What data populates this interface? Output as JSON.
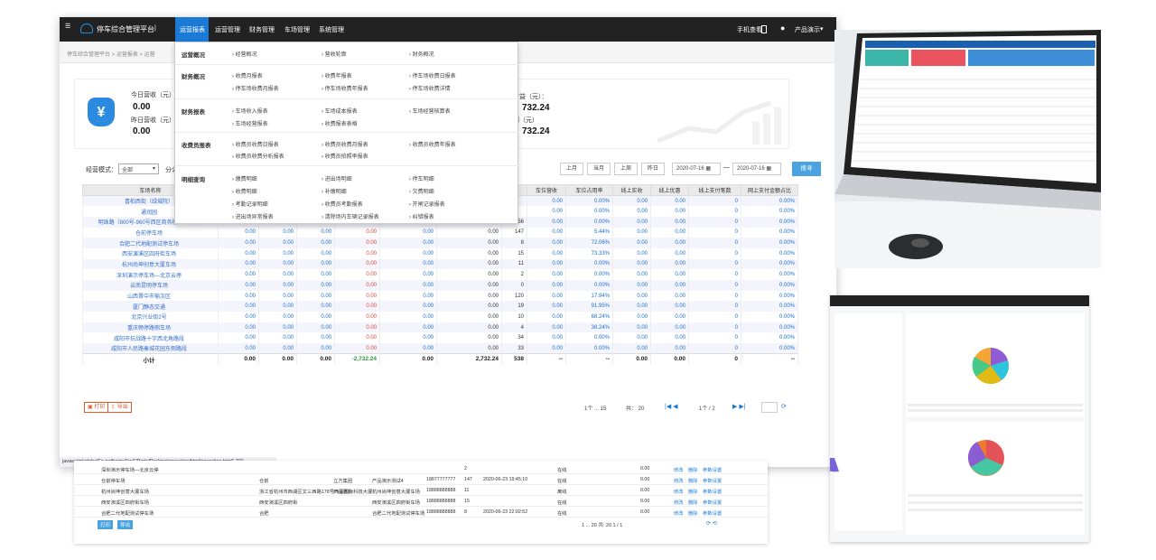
{
  "topbar": {
    "brand": "停车综合管理平台",
    "nav": [
      "运营报表",
      "运营管理",
      "财务管理",
      "车场管理",
      "系统管理"
    ],
    "mobile": "手机查看",
    "user": "产品演示"
  },
  "breadcrumb": "停车综合管理平台 > 运营报表 > 运营",
  "stats": {
    "today_label": "今日营收（元）",
    "today_value": "0.00",
    "yesterday_label": "昨日营收（元）",
    "yesterday_value": "0.00",
    "right_label1": "收益（元）：",
    "right_value1": "732.24",
    "right_label2": "利（元）",
    "right_value2": "732.24"
  },
  "menu": [
    {
      "head": "运营概况",
      "items": [
        "经营概况",
        "营收轮廓",
        "财务概况"
      ]
    },
    {
      "head": "财务概况",
      "items": [
        "收费月报表",
        "收费年报表",
        "停车场收费日报表",
        "停车场收费月报表",
        "停车场收费年报表",
        "停车场收费详情"
      ]
    },
    {
      "head": "财务报表",
      "items": [
        "车场收入报表",
        "车场成本报表",
        "车场经营核算表",
        "车场经营报表",
        "收费报表表格"
      ]
    },
    {
      "head": "收费员报表",
      "items": [
        "收费员收费日报表",
        "收费员收费月报表",
        "收费员收费年报表",
        "收费员收费分析报表",
        "收费员拍照率报表"
      ]
    },
    {
      "head": "明细查询",
      "items": [
        "缴费明细",
        "进出场明细",
        "停车明细",
        "收费明细",
        "补缴明细",
        "欠费明细",
        "考勤记录明细",
        "收费员考勤报表",
        "开闸记录报表",
        "进出场异常报表",
        "清除场内车辆记录报表",
        "纠错报表"
      ]
    }
  ],
  "filter": {
    "mode_label": "经营模式：",
    "mode_value": "全部",
    "split": "分公",
    "buttons": [
      "上月",
      "当月",
      "上周",
      "昨日"
    ],
    "date_from": "2020-07-16",
    "date_sep": "—",
    "date_to": "2020-07-16",
    "search": "搜寻"
  },
  "table": {
    "headers": [
      "车场名称",
      "",
      "",
      "",
      "",
      "",
      "",
      "",
      "车位营收",
      "车位占用率",
      "线上实收",
      "线上优惠",
      "线上支付笔数",
      "网上支付金额占比"
    ],
    "rows": [
      [
        "喜柏西街（绿城院）",
        "",
        "",
        "",
        "",
        "",
        "",
        "",
        "0.00",
        "0.00%",
        "0.00",
        "0.00",
        "0",
        "0.00%"
      ],
      [
        "通润园",
        "",
        "",
        "",
        "",
        "",
        "",
        "",
        "0.00",
        "0.00%",
        "0.00",
        "0.00",
        "0",
        "0.00%"
      ],
      [
        "明珠路（800号-960号西区商务楼82-109）",
        "0.00",
        "0.00",
        "0.00",
        "0.00",
        "0.00",
        "0.00",
        "56",
        "0.00",
        "0.00%",
        "0.00",
        "0.00",
        "0",
        "0.00%"
      ],
      [
        "仓前停车场",
        "0.00",
        "0.00",
        "0.00",
        "0.00",
        "0.00",
        "0.00",
        "147",
        "0.00",
        "5.44%",
        "0.00",
        "0.00",
        "0",
        "0.00%"
      ],
      [
        "合肥二代地配测试停车场",
        "0.00",
        "0.00",
        "0.00",
        "0.00",
        "0.00",
        "0.00",
        "8",
        "0.00",
        "72.06%",
        "0.00",
        "0.00",
        "0",
        "0.00%"
      ],
      [
        "西安演溪区四府街车场",
        "0.00",
        "0.00",
        "0.00",
        "0.00",
        "0.00",
        "0.00",
        "15",
        "0.00",
        "73.33%",
        "0.00",
        "0.00",
        "0",
        "0.00%"
      ],
      [
        "杭州尚坤创意大厦车场",
        "0.00",
        "0.00",
        "0.00",
        "0.00",
        "0.00",
        "0.00",
        "11",
        "0.00",
        "0.00%",
        "0.00",
        "0.00",
        "0",
        "0.00%"
      ],
      [
        "深圳演示停车场—北京云停",
        "0.00",
        "0.00",
        "0.00",
        "0.00",
        "0.00",
        "0.00",
        "2",
        "0.00",
        "0.00%",
        "0.00",
        "0.00",
        "0",
        "0.00%"
      ],
      [
        "云南昆明停车场",
        "0.00",
        "0.00",
        "0.00",
        "0.00",
        "0.00",
        "0.00",
        "0",
        "0.00",
        "0.00%",
        "0.00",
        "0.00",
        "0",
        "0.00%"
      ],
      [
        "山西晋中市榆次区",
        "0.00",
        "0.00",
        "0.00",
        "0.00",
        "0.00",
        "0.00",
        "120",
        "0.00",
        "17.94%",
        "0.00",
        "0.00",
        "0",
        "0.00%"
      ],
      [
        "厦门静态交通",
        "0.00",
        "0.00",
        "0.00",
        "0.00",
        "0.00",
        "0.00",
        "19",
        "0.00",
        "91.95%",
        "0.00",
        "0.00",
        "0",
        "0.00%"
      ],
      [
        "北京兴业街2号",
        "0.00",
        "0.00",
        "0.00",
        "0.00",
        "0.00",
        "0.00",
        "10",
        "0.00",
        "68.24%",
        "0.00",
        "0.00",
        "0",
        "0.00%"
      ],
      [
        "重庆畅停路侧车场",
        "0.00",
        "0.00",
        "0.00",
        "0.00",
        "0.00",
        "0.00",
        "4",
        "0.00",
        "38.24%",
        "0.00",
        "0.00",
        "0",
        "0.00%"
      ],
      [
        "咸阳市抗战路十字西北角路段",
        "0.00",
        "0.00",
        "0.00",
        "0.00",
        "0.00",
        "0.00",
        "34",
        "0.00",
        "0.00%",
        "0.00",
        "0.00",
        "0",
        "0.00%"
      ],
      [
        "咸阳市人民路秦城花园东侧路段",
        "0.00",
        "0.00",
        "0.00",
        "0.00",
        "0.00",
        "0.00",
        "33",
        "0.00",
        "0.00%",
        "0.00",
        "0.00",
        "0",
        "0.00%"
      ]
    ],
    "sum": [
      "小计",
      "0.00",
      "0.00",
      "0.00",
      "-2,732.24",
      "0.00",
      "2,732.24",
      "538",
      "--",
      "--",
      "0.00",
      "0.00",
      "0",
      "--"
    ]
  },
  "pager": {
    "print": "打印",
    "export": "导出",
    "range": "1个 ... 15",
    "total": "共： 20",
    "page": "1个 / 2"
  },
  "status": "javascript:globalFn.getframeSrc(\"/PortalParking/operation/html/operation.html\",\"0\")",
  "back": {
    "rows": [
      [
        "深圳演示停车场—北京云停",
        "",
        "",
        "",
        "",
        "2",
        "",
        "在线",
        "",
        "0.00",
        "修改",
        "删除",
        "参数设置"
      ],
      [
        "仓前停车场",
        "仓前",
        "立方集团",
        "产品演示测试4",
        "18877777777",
        "147",
        "2020-06-23 19:45:10",
        "在线",
        "",
        "0.00",
        "修改",
        "删除",
        "参数设置"
      ],
      [
        "杭州尚坤创意大厦车场",
        "浙江省杭州市西湖区文三西路178号西湖国际科技大厦",
        "产品演示",
        "杭州尚坤创意大厦车场",
        "18888888888",
        "11",
        "",
        "离线",
        "",
        "0.00",
        "修改",
        "删除",
        "参数设置"
      ],
      [
        "西安演溪区四府街车场",
        "西安演溪区四府街",
        "",
        "西安演溪区四府街车场",
        "18888888888",
        "15",
        "",
        "在线",
        "",
        "0.00",
        "修改",
        "删除",
        "参数设置"
      ],
      [
        "合肥二代地配测试停车场",
        "合肥",
        "",
        "合肥二代地配测试停车场",
        "18888888888",
        "8",
        "2020-06-23 22:02:52",
        "在线",
        "",
        "0.00",
        "修改",
        "删除",
        "参数设置"
      ]
    ],
    "print": "打印",
    "export": "导出",
    "pager": "1 ... 20  共: 20   1 / 1"
  }
}
